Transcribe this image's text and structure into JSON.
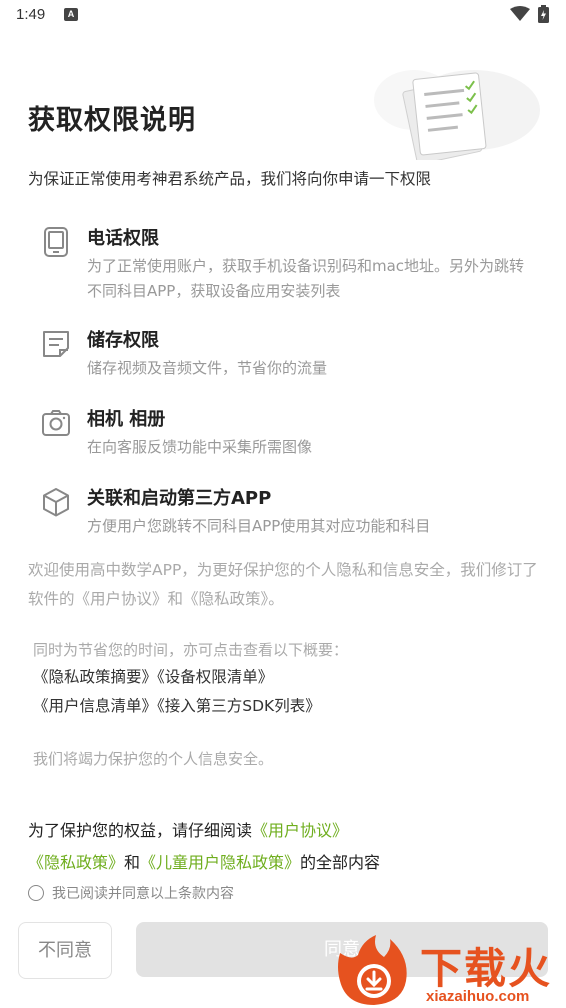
{
  "status_bar": {
    "time": "1:49",
    "notif_icon": "A"
  },
  "title": "获取权限说明",
  "intro": "为保证正常使用考神君系统产品，我们将向你申请一下权限",
  "permissions": [
    {
      "icon": "phone-icon",
      "title": "电话权限",
      "desc": "为了正常使用账户，获取手机设备识别码和mac地址。另外为跳转不同科目APP，获取设备应用安装列表"
    },
    {
      "icon": "storage-icon",
      "title": "储存权限",
      "desc": "储存视频及音频文件，节省你的流量"
    },
    {
      "icon": "camera-icon",
      "title": "相机 相册",
      "desc": "在向客服反馈功能中采集所需图像"
    },
    {
      "icon": "cube-icon",
      "title": "关联和启动第三方APP",
      "desc": "方便用户您跳转不同科目APP使用其对应功能和科目"
    }
  ],
  "welcome_text": "欢迎使用高中数学APP，为更好保护您的个人隐私和信息安全，我们修订了软件的《用户协议》和《隐私政策》。",
  "summary_intro": "同时为节省您的时间，亦可点击查看以下概要：",
  "summary_links": {
    "privacy_summary": "《隐私政策摘要》",
    "device_permissions": "《设备权限清单》",
    "user_info": "《用户信息清单》",
    "sdk_list": "《接入第三方SDK列表》"
  },
  "commitment": "我们将竭力保护您的个人信息安全。",
  "agreement": {
    "prefix": "为了保护您的权益，请仔细阅读",
    "user_agreement": "《用户协议》",
    "privacy_policy": "《隐私政策》",
    "and": "和",
    "child_privacy": "《儿童用户隐私政策》",
    "suffix": "的全部内容"
  },
  "consent_checkbox_label": "我已阅读并同意以上条款内容",
  "buttons": {
    "disagree": "不同意",
    "agree": "同意"
  },
  "watermark": {
    "text": "下载火",
    "url": "xiazaihuo.com"
  },
  "colors": {
    "accent_green": "#6fae1e",
    "watermark_orange": "#e6521f",
    "disabled_button": "#e2e2e2"
  }
}
